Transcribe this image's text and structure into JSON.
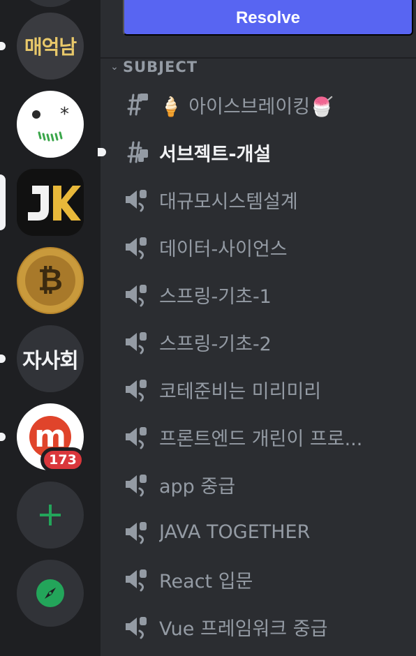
{
  "servers": [
    {
      "label": "매억남",
      "unread": true
    },
    {
      "label": "",
      "unread": false
    },
    {
      "label": "JK",
      "selected": true
    },
    {
      "label": "",
      "unread": false
    },
    {
      "label": "자사회",
      "unread": true
    },
    {
      "label": "m",
      "unread": true,
      "mentions": "173"
    },
    {
      "label": "+",
      "action": "add-server"
    },
    {
      "label": "",
      "action": "explore"
    }
  ],
  "header": {
    "resolve_label": "Resolve"
  },
  "category": {
    "label": "SUBJECT",
    "chevron": "⌄"
  },
  "channels": [
    {
      "type": "text-locked",
      "name": "🍦 아이스브레이킹🍧"
    },
    {
      "type": "text-locked",
      "name": "서브젝트-개설",
      "unread": true
    },
    {
      "type": "voice-locked",
      "name": "대규모시스템설계"
    },
    {
      "type": "voice-locked",
      "name": "데이터-사이언스"
    },
    {
      "type": "voice-locked",
      "name": "스프링-기초-1"
    },
    {
      "type": "voice-locked",
      "name": "스프링-기초-2"
    },
    {
      "type": "voice-locked",
      "name": "코테준비는 미리미리"
    },
    {
      "type": "voice-locked",
      "name": "프론트엔드 개린이 프로..."
    },
    {
      "type": "voice-locked",
      "name": "app 중급"
    },
    {
      "type": "voice-locked",
      "name": "JAVA TOGETHER"
    },
    {
      "type": "voice-locked",
      "name": "React 입문"
    },
    {
      "type": "voice-locked",
      "name": "Vue 프레임워크 중급"
    }
  ],
  "colors": {
    "accent": "#5865f2",
    "badge": "#da373c",
    "add_green": "#23a55a",
    "muted_text": "#949ba4"
  }
}
